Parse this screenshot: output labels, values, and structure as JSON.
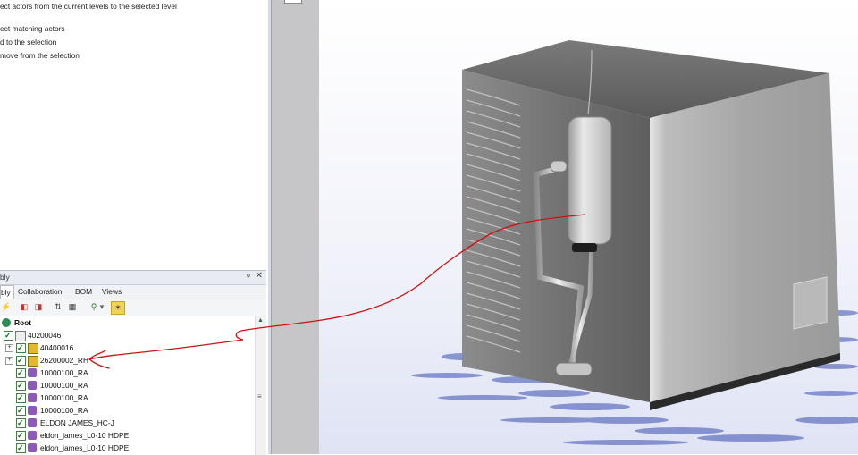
{
  "menu": {
    "items": [
      "ect actors from the current levels to the selected level",
      "ect matching actors",
      "d to the selection",
      "move from the selection"
    ]
  },
  "panel": {
    "title": "bly",
    "pin_glyph": "ᵠ",
    "close_glyph": "✕",
    "tabs": [
      "bly",
      "Collaboration",
      "BOM",
      "Views"
    ],
    "active_tab": "bly"
  },
  "tree": {
    "root": "Root",
    "nodes": [
      {
        "label": "40200046",
        "level": 1,
        "expander": "-",
        "icon": "part-doc-icon"
      },
      {
        "label": "40400016",
        "level": 2,
        "expander": "+",
        "icon": "assembly-icon"
      },
      {
        "label": "26200002_RH",
        "level": 2,
        "expander": "+",
        "icon": "assembly-icon"
      },
      {
        "label": "10000100_RA",
        "level": 2,
        "expander": "",
        "icon": "part-icon"
      },
      {
        "label": "10000100_RA",
        "level": 2,
        "expander": "",
        "icon": "part-icon"
      },
      {
        "label": "10000100_RA",
        "level": 2,
        "expander": "",
        "icon": "part-icon"
      },
      {
        "label": "10000100_RA",
        "level": 2,
        "expander": "",
        "icon": "part-icon"
      },
      {
        "label": "ELDON JAMES_HC-J",
        "level": 2,
        "expander": "",
        "icon": "part-icon"
      },
      {
        "label": "eldon_james_L0-10 HDPE",
        "level": 2,
        "expander": "",
        "icon": "part-icon"
      },
      {
        "label": "eldon_james_L0-10 HDPE",
        "level": 2,
        "expander": "",
        "icon": "part-icon"
      }
    ]
  },
  "colors": {
    "annotation": "#d01010",
    "panel_bg": "#e8ecf2",
    "shadow": "#3a4fb0",
    "cabinet": "#8a8a8a"
  }
}
